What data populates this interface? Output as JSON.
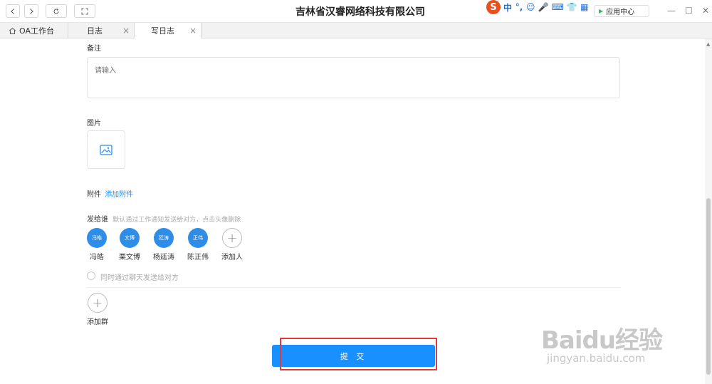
{
  "titlebar": {
    "title": "吉林省汉睿网络科技有限公司",
    "caret": "▾",
    "ime": {
      "logo": "S",
      "items": [
        "中",
        "°,",
        "☺",
        "🎤",
        "⌨",
        "👕",
        "▦"
      ]
    },
    "app_center": "应用中心"
  },
  "tabs": [
    {
      "label": "OA工作台",
      "closable": false,
      "active": false
    },
    {
      "label": "日志",
      "closable": true,
      "active": false
    },
    {
      "label": "写日志",
      "closable": true,
      "active": true
    }
  ],
  "form": {
    "remark_label": "备注",
    "remark_placeholder": "请输入",
    "image_label": "图片",
    "attachment_label": "附件",
    "attachment_link": "添加附件",
    "send_to_label": "发给谁",
    "send_to_hint": "默认通过工作通知发送给对方，点击头像删除",
    "recipients": [
      {
        "avatar": "冯皓",
        "name": "冯皓"
      },
      {
        "avatar": "文博",
        "name": "栗文博"
      },
      {
        "avatar": "廷涛",
        "name": "杨廷涛"
      },
      {
        "avatar": "正伟",
        "name": "陈正伟"
      }
    ],
    "add_person_label": "添加人",
    "chat_option_label": "同时通过聊天发送给对方",
    "add_group_label": "添加群",
    "submit_label": "提 交"
  },
  "watermark": {
    "main": "Baidu经验",
    "sub": "jingyan.baidu.com"
  },
  "colors": {
    "accent": "#1890ff",
    "avatar": "#2e8de8",
    "highlight": "#e53935"
  }
}
